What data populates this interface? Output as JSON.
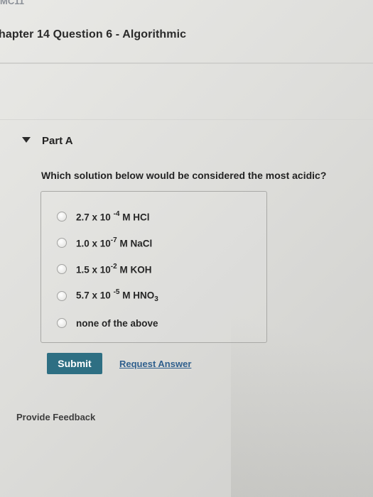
{
  "header": {
    "course_code": "MC11",
    "title": "hapter 14 Question 6 - Algorithmic"
  },
  "part": {
    "label": "Part A",
    "toggle_icon": "caret-down-icon"
  },
  "question": {
    "text": "Which solution below would be considered the most acidic?",
    "options": [
      {
        "coef": "2.7 x 10",
        "exp": "-4",
        "rest": "M HCl",
        "sub": ""
      },
      {
        "coef": "1.0 x 10",
        "exp": "-7",
        "rest": "M NaCl",
        "sub": ""
      },
      {
        "coef": "1.5 x 10",
        "exp": "-2",
        "rest": "M KOH",
        "sub": ""
      },
      {
        "coef": "5.7 x 10",
        "exp": "-5",
        "rest": "M HNO",
        "sub": "3"
      },
      {
        "coef": "none of the above",
        "exp": "",
        "rest": "",
        "sub": ""
      }
    ]
  },
  "actions": {
    "submit_label": "Submit",
    "request_label": "Request Answer"
  },
  "footer": {
    "feedback_label": "Provide Feedback"
  },
  "colors": {
    "submit_bg": "#2e6f83",
    "link": "#2f5f8d"
  }
}
